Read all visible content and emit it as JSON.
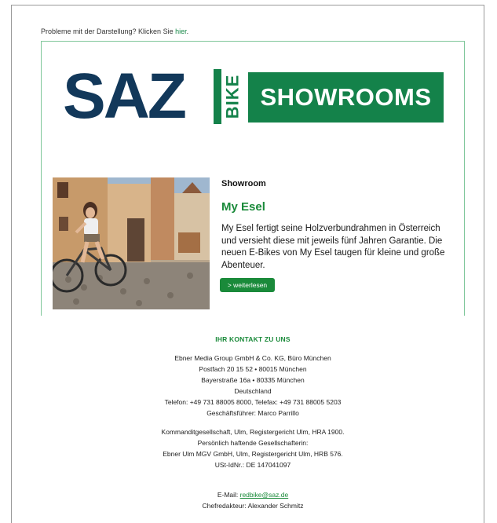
{
  "preheader": {
    "text": "Probleme mit der Darstellung? Klicken Sie ",
    "link": "hier",
    "suffix": "."
  },
  "logo": {
    "saz": "SAZ",
    "bike": "BIKE",
    "showrooms": "SHOWROOMS"
  },
  "article": {
    "kicker": "Showroom",
    "headline": "My Esel",
    "description": "My Esel fertigt seine Holzverbundrahmen in Österreich und versieht diese mit jeweils fünf Jahren Garantie. Die neuen E-Bikes von My Esel taugen für kleine und große Abenteuer.",
    "button": "> weiterlesen"
  },
  "contact": {
    "title": "IHR KONTAKT ZU UNS",
    "address": [
      "Ebner Media Group GmbH & Co. KG, Büro München",
      "Postfach 20 15 52 • 80015 München",
      "Bayerstraße 16a • 80335 München",
      "Deutschland",
      "Telefon: +49 731 88005 8000, Telefax: +49 731 88005 5203",
      "Geschäftsführer: Marco Parrillo"
    ],
    "legal": [
      "Kommanditgesellschaft, Ulm, Registergericht Ulm, HRA 1900.",
      "Persönlich haftende Gesellschafterin:",
      "Ebner Ulm MGV GmbH, Ulm, Registergericht Ulm, HRB 576.",
      "USt-IdNr.: DE 147041097"
    ],
    "email_label": "E-Mail: ",
    "email": "redbike@saz.de",
    "editor": "Chefredakteur: Alexander Schmitz"
  },
  "colors": {
    "brand_green": "#14824a",
    "brand_navy": "#12385a"
  }
}
